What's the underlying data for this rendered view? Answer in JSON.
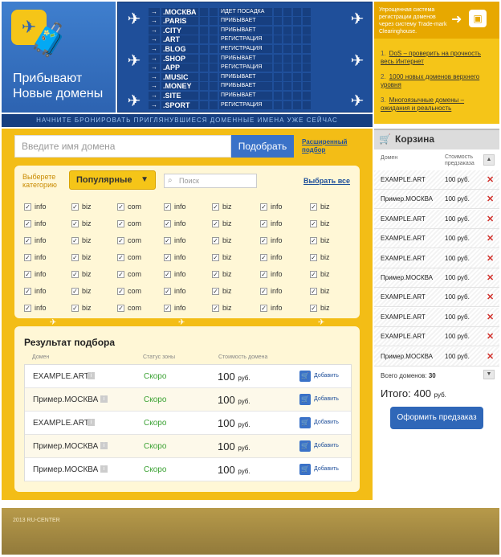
{
  "header": {
    "title_line1": "Прибывают",
    "title_line2": "Новые домены",
    "board": [
      {
        "domain": ".МОСКВА",
        "status": "ИДЕТ ПОСАДКА"
      },
      {
        "domain": ".PARIS",
        "status": "ПРИБЫВАЕТ"
      },
      {
        "domain": ".CITY",
        "status": "ПРИБЫВАЕТ"
      },
      {
        "domain": ".ART",
        "status": "РЕГИСТРАЦИЯ"
      },
      {
        "domain": ".BLOG",
        "status": "РЕГИСТРАЦИЯ"
      },
      {
        "domain": ".SHOP",
        "status": "ПРИБЫВАЕТ"
      },
      {
        "domain": ".APP",
        "status": "РЕГИСТРАЦИЯ"
      },
      {
        "domain": ".MUSIC",
        "status": "ПРИБЫВАЕТ"
      },
      {
        "domain": ".MONEY",
        "status": "ПРИБЫВАЕТ"
      },
      {
        "domain": ".SITE",
        "status": "ПРИБЫВАЕТ"
      },
      {
        "domain": ".SPORT",
        "status": "РЕГИСТРАЦИЯ"
      }
    ],
    "slogan": "НАЧНИТЕ БРОНИРОВАТЬ ПРИГЛЯНУВШИЕСЯ ДОМЕННЫЕ ИМЕНА УЖЕ СЕЙЧАС",
    "promo_text": "Упрощенная система регистрации доменов через систему Trade-mark Clearinghouse.",
    "news": [
      {
        "n": "1.",
        "text": "DoS – проверить на прочность весь Интернет"
      },
      {
        "n": "2.",
        "text": "1000 новых доменов верхнего уровня"
      },
      {
        "n": "3.",
        "text": "Многоязычные домены – ожидания и реальность"
      }
    ]
  },
  "search": {
    "placeholder": "Введите имя домена",
    "button": "Подобрать",
    "advanced": "Расширенный подбор"
  },
  "filter": {
    "category_label": "Выберете категорию",
    "category_value": "Популярные",
    "search_placeholder": "Поиск",
    "select_all": "Выбрать все",
    "columns": [
      "info",
      "biz",
      "com",
      "info",
      "biz",
      "info",
      "biz"
    ]
  },
  "results": {
    "title": "Результат подбора",
    "col_domain": "Домен",
    "col_status": "Статус зоны",
    "col_price": "Стоимость домена",
    "rows": [
      {
        "domain": "EXAMPLE.ART",
        "status": "Скоро",
        "price": "100",
        "currency": "руб.",
        "action": "Добавить"
      },
      {
        "domain": "Пример.МОСКВА",
        "status": "Скоро",
        "price": "100",
        "currency": "руб.",
        "action": "Добавить"
      },
      {
        "domain": "EXAMPLE.ART",
        "status": "Скоро",
        "price": "100",
        "currency": "руб.",
        "action": "Добавить"
      },
      {
        "domain": "Пример.МОСКВА",
        "status": "Скоро",
        "price": "100",
        "currency": "руб.",
        "action": "Добавить"
      },
      {
        "domain": "Пример.МОСКВА",
        "status": "Скоро",
        "price": "100",
        "currency": "руб.",
        "action": "Добавить"
      }
    ]
  },
  "cart": {
    "title": "Корзина",
    "col_domain": "Домен",
    "col_price": "Стоимость предзаказа",
    "rows": [
      {
        "domain": "EXAMPLE.ART",
        "price": "100 руб."
      },
      {
        "domain": "Пример.МОСКВА",
        "price": "100 руб."
      },
      {
        "domain": "EXAMPLE.ART",
        "price": "100 руб."
      },
      {
        "domain": "EXAMPLE.ART",
        "price": "100 руб."
      },
      {
        "domain": "EXAMPLE.ART",
        "price": "100 руб."
      },
      {
        "domain": "Пример.МОСКВА",
        "price": "100 руб."
      },
      {
        "domain": "EXAMPLE.ART",
        "price": "100 руб."
      },
      {
        "domain": "EXAMPLE.ART",
        "price": "100 руб."
      },
      {
        "domain": "EXAMPLE.ART",
        "price": "100 руб."
      },
      {
        "domain": "Пример.МОСКВА",
        "price": "100 руб."
      }
    ],
    "total_domains_label": "Всего доменов:",
    "total_domains": "30",
    "total_label": "Итого:",
    "total_value": "400",
    "total_currency": "руб.",
    "order_button": "Оформить предзаказ"
  },
  "footer": {
    "text": "2013 RU-CENTER"
  }
}
